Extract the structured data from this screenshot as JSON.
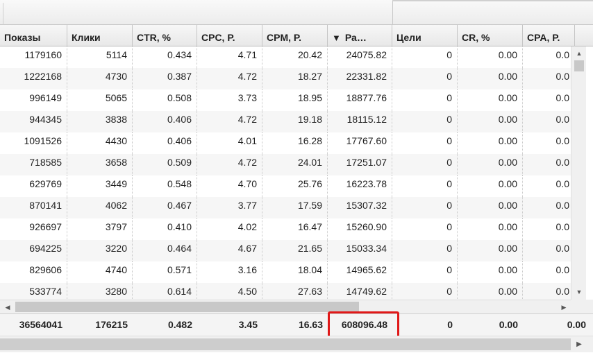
{
  "table": {
    "columns": [
      {
        "label": "Показы"
      },
      {
        "label": "Клики"
      },
      {
        "label": "CTR, %"
      },
      {
        "label": "CPC, Р."
      },
      {
        "label": "CPM, Р."
      },
      {
        "label": "Ра…",
        "sorted": "descending",
        "sort_icon": "sort-descending-icon"
      },
      {
        "label": "Цели"
      },
      {
        "label": "CR, %"
      },
      {
        "label": "CPA, Р."
      }
    ],
    "rows": [
      [
        "1179160",
        "5114",
        "0.434",
        "4.71",
        "20.42",
        "24075.82",
        "0",
        "0.00",
        "0.0"
      ],
      [
        "1222168",
        "4730",
        "0.387",
        "4.72",
        "18.27",
        "22331.82",
        "0",
        "0.00",
        "0.0"
      ],
      [
        "996149",
        "5065",
        "0.508",
        "3.73",
        "18.95",
        "18877.76",
        "0",
        "0.00",
        "0.0"
      ],
      [
        "944345",
        "3838",
        "0.406",
        "4.72",
        "19.18",
        "18115.12",
        "0",
        "0.00",
        "0.0"
      ],
      [
        "1091526",
        "4430",
        "0.406",
        "4.01",
        "16.28",
        "17767.60",
        "0",
        "0.00",
        "0.0"
      ],
      [
        "718585",
        "3658",
        "0.509",
        "4.72",
        "24.01",
        "17251.07",
        "0",
        "0.00",
        "0.0"
      ],
      [
        "629769",
        "3449",
        "0.548",
        "4.70",
        "25.76",
        "16223.78",
        "0",
        "0.00",
        "0.0"
      ],
      [
        "870141",
        "4062",
        "0.467",
        "3.77",
        "17.59",
        "15307.32",
        "0",
        "0.00",
        "0.0"
      ],
      [
        "926697",
        "3797",
        "0.410",
        "4.02",
        "16.47",
        "15260.90",
        "0",
        "0.00",
        "0.0"
      ],
      [
        "694225",
        "3220",
        "0.464",
        "4.67",
        "21.65",
        "15033.34",
        "0",
        "0.00",
        "0.0"
      ],
      [
        "829606",
        "4740",
        "0.571",
        "3.16",
        "18.04",
        "14965.62",
        "0",
        "0.00",
        "0.0"
      ],
      [
        "533774",
        "3280",
        "0.614",
        "4.50",
        "27.63",
        "14749.62",
        "0",
        "0.00",
        "0.0"
      ]
    ],
    "totals": [
      "36564041",
      "176215",
      "0.482",
      "3.45",
      "16.63",
      "608096.48",
      "0",
      "0.00",
      "0.00"
    ],
    "highlight_color": "#e01818"
  },
  "scrollbars": {
    "up_icon": "▲",
    "down_icon": "▼",
    "left_icon": "◀",
    "right_icon": "▶"
  }
}
